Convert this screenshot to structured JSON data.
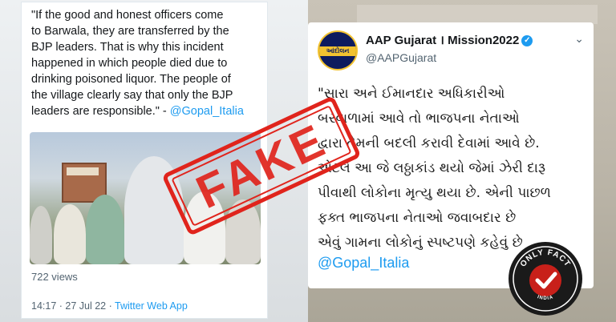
{
  "left_tweet": {
    "text_lines": [
      "\"If the good and honest officers come",
      "to Barwala, they are transferred by the",
      "BJP leaders. That is why this incident",
      "happened in which people died due to",
      "drinking poisoned liquor. The people of",
      "the village clearly say that only the BJP",
      "leaders are responsible.\" - "
    ],
    "mention": "@Gopal_Italia",
    "views": "722 views",
    "timestamp": "14:17 · 27 Jul 22 · ",
    "source": "Twitter Web App"
  },
  "right_tweet": {
    "avatar_label": "આંદોલન",
    "account_name": "AAP Gujarat । Mission2022",
    "handle": "@AAPGujarat",
    "text_lines": [
      "\"સારા અને ઈમાનદાર અધિકારીઓ",
      "બરવાળામાં આવે તો ભાજપના નેતાઓ",
      "દ્વારા તેમની બદલી કરાવી દેવામાં આવે છે.",
      "એટલે આ જે લઠ્ઠાકાંડ થયો જેમાં ઝેરી દારૂ",
      "પીવાથી લોકોના મૃત્યુ થયા છે. એની પાછળ",
      "ફક્ત ભાજપના નેતાઓ જવાબદાર છે",
      "એવું ગામના લોકોનું સ્પષ્ટપણે કહેવું છે"
    ],
    "mention": "@Gopal_Italia"
  },
  "stamp": {
    "label": "FAKE",
    "color": "#e0241c"
  },
  "badge": {
    "top": "ONLY FACT",
    "bottom": "INDIA",
    "color": "#c8201a"
  },
  "icons": [
    "verified-icon",
    "chevron-down-icon",
    "checkmark-icon"
  ]
}
